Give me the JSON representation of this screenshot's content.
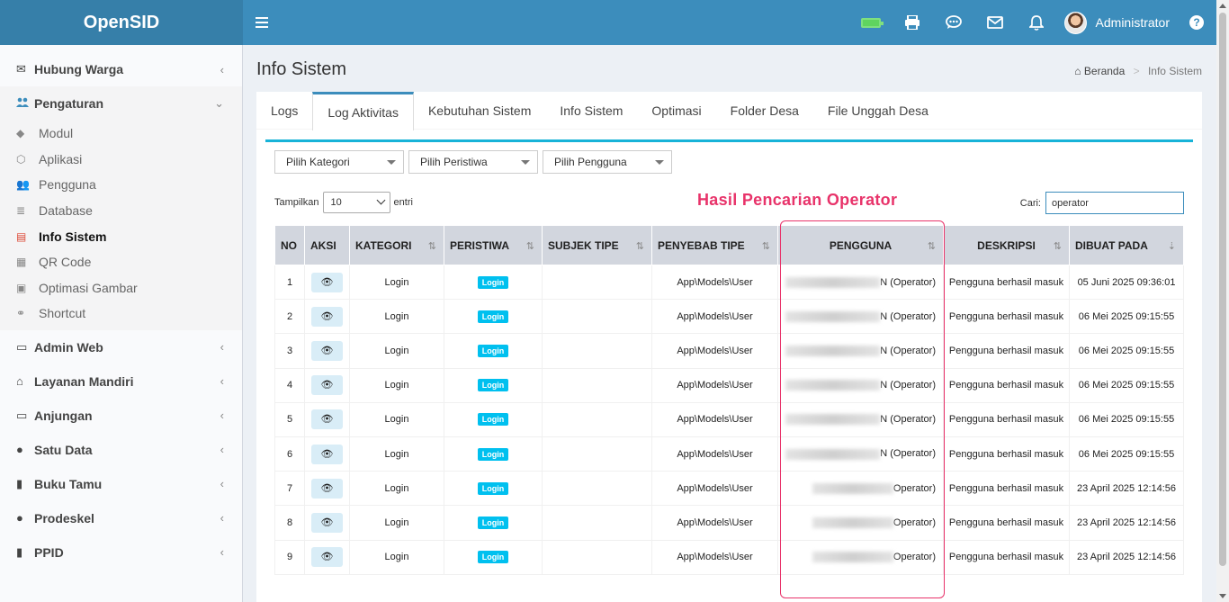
{
  "header": {
    "brand": "OpenSID",
    "user_name": "Administrator",
    "help": "?"
  },
  "sidebar": {
    "items": [
      {
        "label": "Hubung Warga",
        "icon": "envelope-icon",
        "caret": "‹"
      },
      {
        "label": "Pengaturan",
        "icon": "users-cog-icon",
        "caret": "⌄"
      },
      {
        "label": "Admin Web",
        "icon": "desktop-icon",
        "caret": "‹"
      },
      {
        "label": "Layanan Mandiri",
        "icon": "inbox-icon",
        "caret": "‹"
      },
      {
        "label": "Anjungan",
        "icon": "monitor-icon",
        "caret": "‹"
      },
      {
        "label": "Satu Data",
        "icon": "globe-icon",
        "caret": "‹"
      },
      {
        "label": "Buku Tamu",
        "icon": "book-icon",
        "caret": "‹"
      },
      {
        "label": "Prodeskel",
        "icon": "globe-icon",
        "caret": "‹"
      },
      {
        "label": "PPID",
        "icon": "book-icon",
        "caret": "‹"
      }
    ],
    "submenu": [
      {
        "label": "Modul",
        "icon": "tags-icon"
      },
      {
        "label": "Aplikasi",
        "icon": "cube-icon"
      },
      {
        "label": "Pengguna",
        "icon": "users-icon"
      },
      {
        "label": "Database",
        "icon": "database-icon"
      },
      {
        "label": "Info Sistem",
        "icon": "server-icon"
      },
      {
        "label": "QR Code",
        "icon": "qrcode-icon"
      },
      {
        "label": "Optimasi Gambar",
        "icon": "image-icon"
      },
      {
        "label": "Shortcut",
        "icon": "link-icon"
      }
    ]
  },
  "page": {
    "title": "Info Sistem",
    "breadcrumb_home": "Beranda",
    "breadcrumb_sep": ">",
    "breadcrumb_current": "Info Sistem"
  },
  "tabs": [
    "Logs",
    "Log Aktivitas",
    "Kebutuhan Sistem",
    "Info Sistem",
    "Optimasi",
    "Folder Desa",
    "File Unggah Desa"
  ],
  "filters": {
    "kategori": "Pilih Kategori",
    "peristiwa": "Pilih Peristiwa",
    "pengguna": "Pilih Pengguna"
  },
  "table_controls": {
    "show_label": "Tampilkan",
    "show_value": "10",
    "entries_label": "entri",
    "search_label": "Cari:",
    "search_value": "operator"
  },
  "annotation": "Hasil Pencarian Operator",
  "table": {
    "headers": [
      "NO",
      "AKSI",
      "KATEGORI",
      "PERISTIWA",
      "SUBJEK TIPE",
      "PENYEBAB TIPE",
      "PENGGUNA",
      "DESKRIPSI",
      "DIBUAT PADA"
    ],
    "rows": [
      {
        "no": "1",
        "kategori": "Login",
        "peristiwa": "Login",
        "subjek": "",
        "penyebab": "App\\Models\\User",
        "pengguna": "N (Operator)",
        "deskripsi": "Pengguna berhasil masuk",
        "dibuat": "05 Juni 2025 09:36:01"
      },
      {
        "no": "2",
        "kategori": "Login",
        "peristiwa": "Login",
        "subjek": "",
        "penyebab": "App\\Models\\User",
        "pengguna": "N (Operator)",
        "deskripsi": "Pengguna berhasil masuk",
        "dibuat": "06 Mei 2025 09:15:55"
      },
      {
        "no": "3",
        "kategori": "Login",
        "peristiwa": "Login",
        "subjek": "",
        "penyebab": "App\\Models\\User",
        "pengguna": "N (Operator)",
        "deskripsi": "Pengguna berhasil masuk",
        "dibuat": "06 Mei 2025 09:15:55"
      },
      {
        "no": "4",
        "kategori": "Login",
        "peristiwa": "Login",
        "subjek": "",
        "penyebab": "App\\Models\\User",
        "pengguna": "N (Operator)",
        "deskripsi": "Pengguna berhasil masuk",
        "dibuat": "06 Mei 2025 09:15:55"
      },
      {
        "no": "5",
        "kategori": "Login",
        "peristiwa": "Login",
        "subjek": "",
        "penyebab": "App\\Models\\User",
        "pengguna": "N (Operator)",
        "deskripsi": "Pengguna berhasil masuk",
        "dibuat": "06 Mei 2025 09:15:55"
      },
      {
        "no": "6",
        "kategori": "Login",
        "peristiwa": "Login",
        "subjek": "",
        "penyebab": "App\\Models\\User",
        "pengguna": "N (Operator)",
        "deskripsi": "Pengguna berhasil masuk",
        "dibuat": "06 Mei 2025 09:15:55"
      },
      {
        "no": "7",
        "kategori": "Login",
        "peristiwa": "Login",
        "subjek": "",
        "penyebab": "App\\Models\\User",
        "pengguna": "Operator)",
        "deskripsi": "Pengguna berhasil masuk",
        "dibuat": "23 April 2025 12:14:56"
      },
      {
        "no": "8",
        "kategori": "Login",
        "peristiwa": "Login",
        "subjek": "",
        "penyebab": "App\\Models\\User",
        "pengguna": "Operator)",
        "deskripsi": "Pengguna berhasil masuk",
        "dibuat": "23 April 2025 12:14:56"
      },
      {
        "no": "9",
        "kategori": "Login",
        "peristiwa": "Login",
        "subjek": "",
        "penyebab": "App\\Models\\User",
        "pengguna": "Operator)",
        "deskripsi": "Pengguna berhasil masuk",
        "dibuat": "23 April 2025 12:14:56"
      }
    ]
  },
  "colors": {
    "header": "#3c8dbc",
    "brand_bg": "#367fa9",
    "accent": "#17b3d8",
    "badge": "#00c0ef",
    "annotation": "#e8336a",
    "active_icon": "#dd4b39"
  }
}
